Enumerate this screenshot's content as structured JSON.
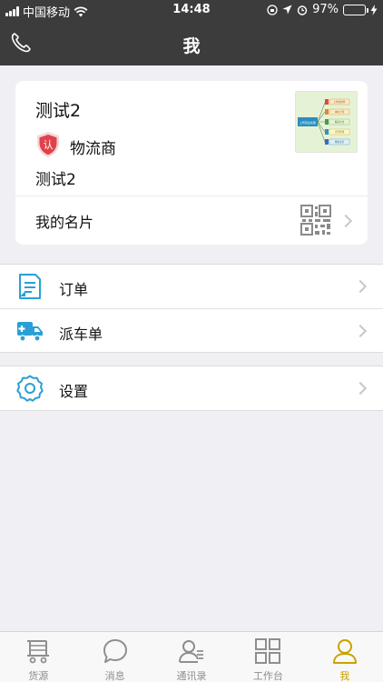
{
  "status": {
    "carrier": "中国移动",
    "time": "14:48",
    "battery": "97%",
    "battery_level": 0.97
  },
  "nav": {
    "title": "我"
  },
  "profile": {
    "name": "测试2",
    "role": "物流商",
    "company": "测试2",
    "badge_text": "认",
    "bizcard_label": "我的名片",
    "thumb_lines": [
      "上传的文件",
      "本地上传",
      "联系方式",
      "合同管理",
      "物流业务"
    ],
    "thumb_center": "上传营业执照"
  },
  "menu_section_1": [
    {
      "label": "订单",
      "icon": "order-document-icon"
    },
    {
      "label": "派车单",
      "icon": "dispatch-truck-icon"
    }
  ],
  "menu_section_2": [
    {
      "label": "设置",
      "icon": "settings-gear-icon"
    }
  ],
  "tabs": [
    {
      "label": "货源",
      "icon": "cargo-cart-icon",
      "active": false
    },
    {
      "label": "消息",
      "icon": "message-bubble-icon",
      "active": false
    },
    {
      "label": "通讯录",
      "icon": "contacts-icon",
      "active": false
    },
    {
      "label": "工作台",
      "icon": "workbench-grid-icon",
      "active": false
    },
    {
      "label": "我",
      "icon": "profile-person-icon",
      "active": true
    }
  ],
  "colors": {
    "bar_bg": "#3c3c3c",
    "accent_blue": "#2a9fd6",
    "tab_active": "#c9a100",
    "badge_red": "#e0424b"
  }
}
